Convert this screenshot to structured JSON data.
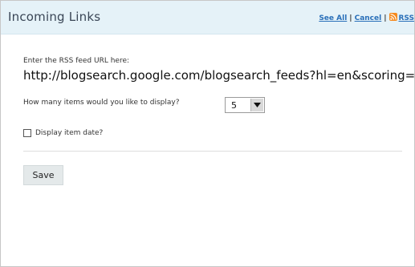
{
  "header": {
    "title": "Incoming Links",
    "see_all": "See All",
    "separator": "|",
    "cancel": "Cancel",
    "rss": "RSS"
  },
  "form": {
    "feed_label": "Enter the RSS feed URL here:",
    "feed_url": "http://blogsearch.google.com/blogsearch_feeds?hl=en&scoring=d&",
    "items_label": "How many items would you like to display?",
    "items_value": "5",
    "date_label": "Display item date?",
    "date_checked": false,
    "save_label": "Save"
  },
  "colors": {
    "header_bg": "#e5f2f8",
    "link": "#2a70b9",
    "rss_orange": "#f58a1f",
    "button_bg": "#e4e9ea"
  },
  "icons": {
    "rss": "rss-feed-icon",
    "dropdown": "chevron-down-icon"
  }
}
